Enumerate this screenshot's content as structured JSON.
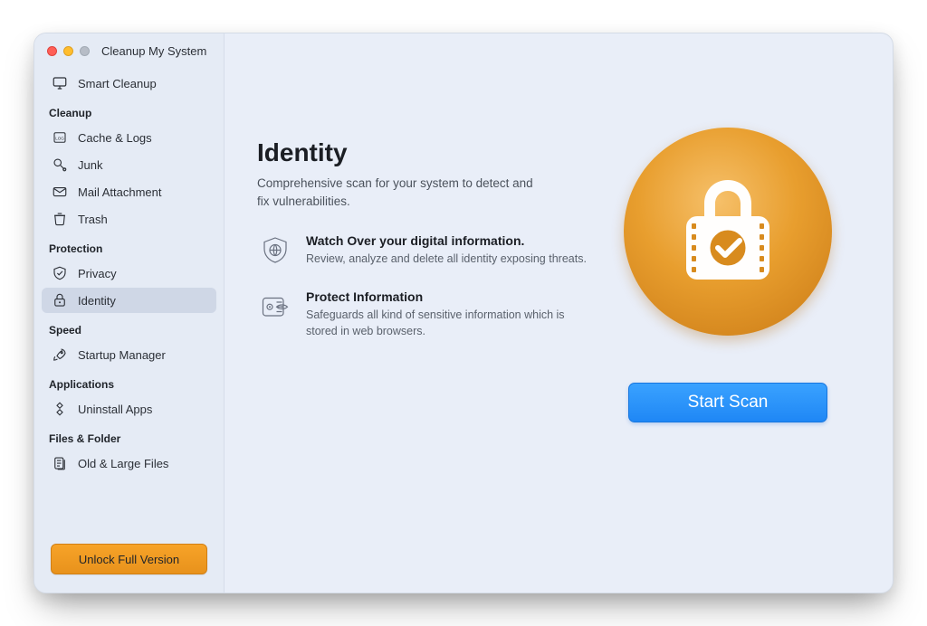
{
  "window": {
    "title": "Cleanup My System"
  },
  "sidebar": {
    "smart_cleanup": "Smart Cleanup",
    "sections": {
      "cleanup": {
        "label": "Cleanup",
        "items": [
          "Cache & Logs",
          "Junk",
          "Mail Attachment",
          "Trash"
        ]
      },
      "protection": {
        "label": "Protection",
        "items": [
          "Privacy",
          "Identity"
        ]
      },
      "speed": {
        "label": "Speed",
        "items": [
          "Startup Manager"
        ]
      },
      "applications": {
        "label": "Applications",
        "items": [
          "Uninstall Apps"
        ]
      },
      "files": {
        "label": "Files & Folder",
        "items": [
          "Old & Large Files"
        ]
      }
    },
    "unlock_label": "Unlock Full Version"
  },
  "main": {
    "title": "Identity",
    "description": "Comprehensive scan for your system to detect and fix vulnerabilities.",
    "features": [
      {
        "title": "Watch Over your digital information.",
        "desc": "Review, analyze and delete all identity exposing threats."
      },
      {
        "title": "Protect Information",
        "desc": "Safeguards all kind of sensitive information which is stored in web browsers."
      }
    ],
    "start_label": "Start Scan"
  }
}
